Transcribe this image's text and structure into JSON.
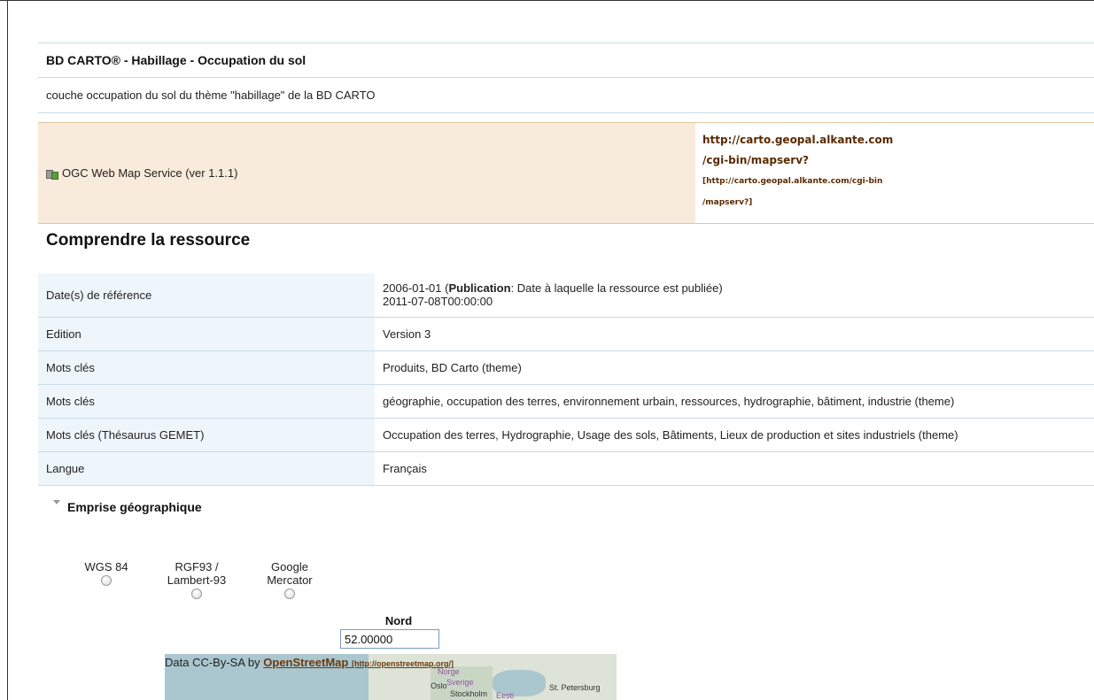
{
  "header": {
    "title": "BD CARTO® - Habillage - Occupation du sol",
    "abstract": "couche occupation du sol du thème \"habillage\" de la BD CARTO"
  },
  "service": {
    "label": "OGC Web Map Service (ver 1.1.1)",
    "icon": "map-service-icon",
    "url_line1": "http://carto.geopal.alkante.com",
    "url_line2": "/cgi-bin/mapserv?",
    "url_small1": "[http://carto.geopal.alkante.com/cgi-bin",
    "url_small2": "/mapserv?]"
  },
  "section": {
    "title": "Comprendre la ressource"
  },
  "metadata": {
    "ref_date_key": "Date(s) de référence",
    "ref_date_value1": "2006-01-01",
    "ref_date_type": "Publication",
    "ref_date_desc": ": Date à laquelle la ressource est publiée)",
    "ref_date_value2": "2011-07-08T00:00:00",
    "rows": [
      {
        "key": "Edition",
        "value": "Version 3"
      },
      {
        "key": "Mots clés",
        "value": "Produits, BD Carto (theme)"
      },
      {
        "key": "Mots clés",
        "value": "géographie, occupation des terres, environnement urbain, ressources, hydrographie, bâtiment, industrie (theme)"
      },
      {
        "key": "Mots clés (Thésaurus GEMET)",
        "value": "Occupation des terres, Hydrographie, Usage des sols, Bâtiments, Lieux de production et sites industriels (theme)"
      },
      {
        "key": "Langue",
        "value": "Français"
      }
    ]
  },
  "emprise": {
    "label": "Emprise géographique",
    "projections": [
      {
        "line1": "WGS 84",
        "line2": ""
      },
      {
        "line1": "RGF93 /",
        "line2": "Lambert-93"
      },
      {
        "line1": "Google",
        "line2": "Mercator"
      }
    ],
    "nord_label": "Nord",
    "nord_value": "52.00000"
  },
  "map": {
    "attribution_prefix": "Data CC-By-SA by ",
    "attribution_link": "OpenStreetMap",
    "attribution_url": "[http://openstreetmap.org/]",
    "places": {
      "norge": "Norge",
      "oslo": "Oslo",
      "sverige": "Sverige",
      "stpetersburg": "St. Petersburg",
      "stockholm": "Stockholm",
      "eesti": "Eesti"
    }
  }
}
